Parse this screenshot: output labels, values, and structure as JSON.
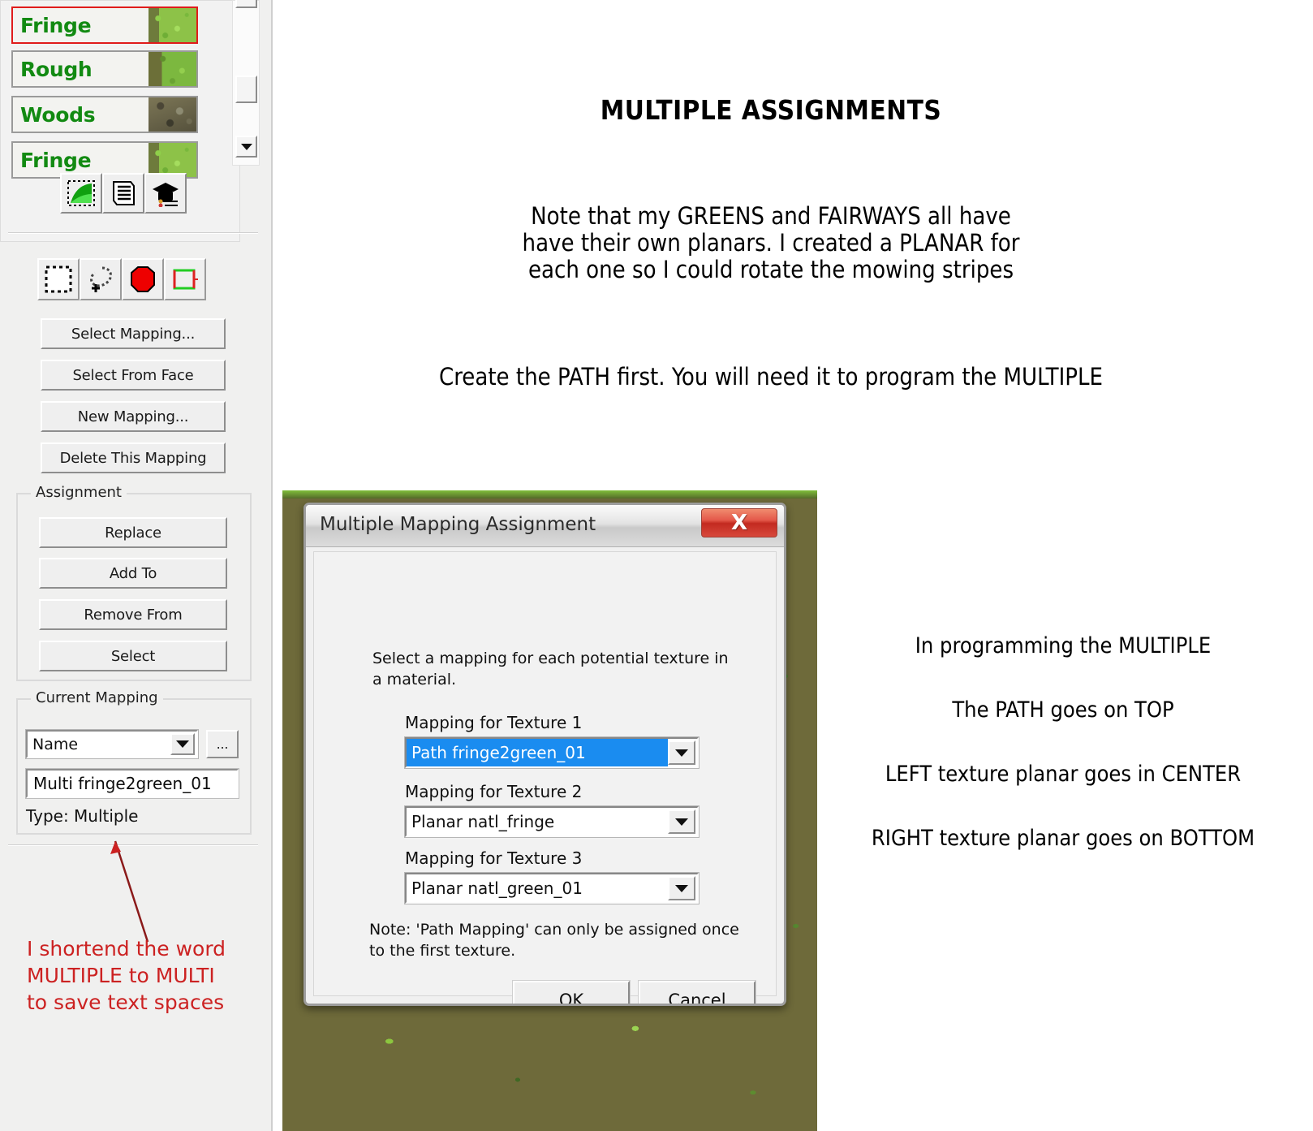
{
  "left_panel": {
    "material_list": {
      "items": [
        {
          "label": "Fringe",
          "selected": true,
          "swatch": "fringe-texture-swatch"
        },
        {
          "label": "Rough",
          "selected": false,
          "swatch": "rough-texture-swatch"
        },
        {
          "label": "Woods",
          "selected": false,
          "swatch": "woods-texture-swatch"
        },
        {
          "label": "Fringe",
          "selected": false,
          "swatch": "fringe-texture-swatch"
        }
      ],
      "icon_buttons": [
        {
          "name": "texture-page-icon"
        },
        {
          "name": "list-document-icon"
        },
        {
          "name": "graduation-cap-icon"
        }
      ],
      "scrollbar": {
        "up": "scroll-up-button",
        "thumb": "scroll-thumb",
        "down": "scroll-down-button"
      }
    },
    "mode_toolbar": [
      {
        "name": "rectangle-select-icon"
      },
      {
        "name": "lasso-add-select-icon"
      },
      {
        "name": "red-polygon-icon"
      },
      {
        "name": "green-red-box-icon"
      }
    ],
    "mapping_buttons": [
      {
        "label": "Select Mapping..."
      },
      {
        "label": "Select From Face"
      },
      {
        "label": "New Mapping..."
      },
      {
        "label": "Delete This Mapping"
      }
    ],
    "assignment": {
      "legend": "Assignment",
      "buttons": [
        {
          "label": "Replace"
        },
        {
          "label": "Add To"
        },
        {
          "label": "Remove From"
        },
        {
          "label": "Select"
        }
      ]
    },
    "current_mapping": {
      "legend": "Current Mapping",
      "name_combo_value": "Name",
      "browse_button_label": "...",
      "name_field_value": "Multi fringe2green_01",
      "type_text": "Type: Multiple"
    },
    "red_note": {
      "lines": [
        "I shortend the word",
        "MULTIPLE to MULTI",
        "to save text spaces"
      ],
      "color": "#cc2222"
    }
  },
  "dialog": {
    "title": "Multiple Mapping Assignment",
    "close_label": "X",
    "close_color": "#c32a20",
    "instruction": "Select a mapping for each potential texture in a material.",
    "fields": [
      {
        "label": "Mapping for Texture 1",
        "value": "Path fringe2green_01",
        "selected": true
      },
      {
        "label": "Mapping for Texture 2",
        "value": "Planar natl_fringe",
        "selected": false
      },
      {
        "label": "Mapping for Texture 3",
        "value": "Planar natl_green_01",
        "selected": false
      }
    ],
    "note": "Note: 'Path Mapping' can only be assigned once to the first texture.",
    "ok_label": "OK",
    "cancel_label": "Cancel",
    "selection_color": "#1a8cf0"
  },
  "annotations": {
    "title": "MULTIPLE ASSIGNMENTS",
    "paragraph1": [
      "Note that my GREENS and FAIRWAYS all have",
      "have their own planars. I created a PLANAR for",
      "each one so I could rotate the mowing stripes"
    ],
    "paragraph2": "Create the PATH first. You will need it to program the MULTIPLE",
    "right_lines": [
      "In programming the MULTIPLE",
      "The PATH goes on TOP",
      "LEFT texture planar goes in CENTER",
      "RIGHT texture planar goes on BOTTOM"
    ]
  }
}
